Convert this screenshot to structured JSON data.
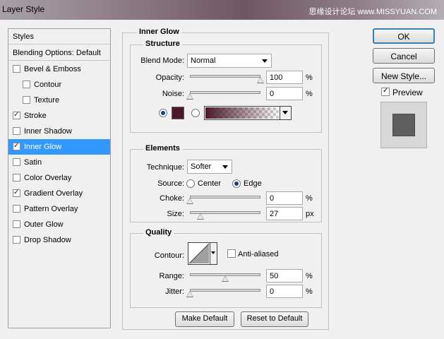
{
  "window": {
    "title": "Layer Style",
    "watermark": "思缘设计论坛 www.MISSYUAN.COM"
  },
  "sidebar": {
    "header": "Styles",
    "blending": "Blending Options: Default",
    "items": [
      {
        "label": "Bevel & Emboss",
        "checked": false,
        "indent": false,
        "selected": false
      },
      {
        "label": "Contour",
        "checked": false,
        "indent": true,
        "selected": false
      },
      {
        "label": "Texture",
        "checked": false,
        "indent": true,
        "selected": false
      },
      {
        "label": "Stroke",
        "checked": true,
        "indent": false,
        "selected": false
      },
      {
        "label": "Inner Shadow",
        "checked": false,
        "indent": false,
        "selected": false
      },
      {
        "label": "Inner Glow",
        "checked": true,
        "indent": false,
        "selected": true
      },
      {
        "label": "Satin",
        "checked": false,
        "indent": false,
        "selected": false
      },
      {
        "label": "Color Overlay",
        "checked": false,
        "indent": false,
        "selected": false
      },
      {
        "label": "Gradient Overlay",
        "checked": true,
        "indent": false,
        "selected": false
      },
      {
        "label": "Pattern Overlay",
        "checked": false,
        "indent": false,
        "selected": false
      },
      {
        "label": "Outer Glow",
        "checked": false,
        "indent": false,
        "selected": false
      },
      {
        "label": "Drop Shadow",
        "checked": false,
        "indent": false,
        "selected": false
      }
    ]
  },
  "panel": {
    "title": "Inner Glow",
    "structure": {
      "title": "Structure",
      "blend_mode_label": "Blend Mode:",
      "blend_mode": "Normal",
      "opacity_label": "Opacity:",
      "opacity": "100",
      "opacity_fraction": 1.0,
      "noise_label": "Noise:",
      "noise": "0",
      "noise_fraction": 0.0,
      "percent": "%",
      "color": "#4a1a26",
      "gradient_color": "#4a1a26"
    },
    "elements": {
      "title": "Elements",
      "technique_label": "Technique:",
      "technique": "Softer",
      "source_label": "Source:",
      "center_label": "Center",
      "edge_label": "Edge",
      "choke_label": "Choke:",
      "choke": "0",
      "choke_fraction": 0.0,
      "size_label": "Size:",
      "size": "27",
      "size_fraction": 0.15,
      "percent": "%",
      "px": "px"
    },
    "quality": {
      "title": "Quality",
      "contour_label": "Contour:",
      "anti_aliased_label": "Anti-aliased",
      "range_label": "Range:",
      "range": "50",
      "range_fraction": 0.5,
      "jitter_label": "Jitter:",
      "jitter": "0",
      "jitter_fraction": 0.0,
      "percent": "%"
    },
    "make_default": "Make Default",
    "reset_default": "Reset to Default"
  },
  "buttons": {
    "ok": "OK",
    "cancel": "Cancel",
    "new_style": "New Style...",
    "preview_label": "Preview"
  }
}
